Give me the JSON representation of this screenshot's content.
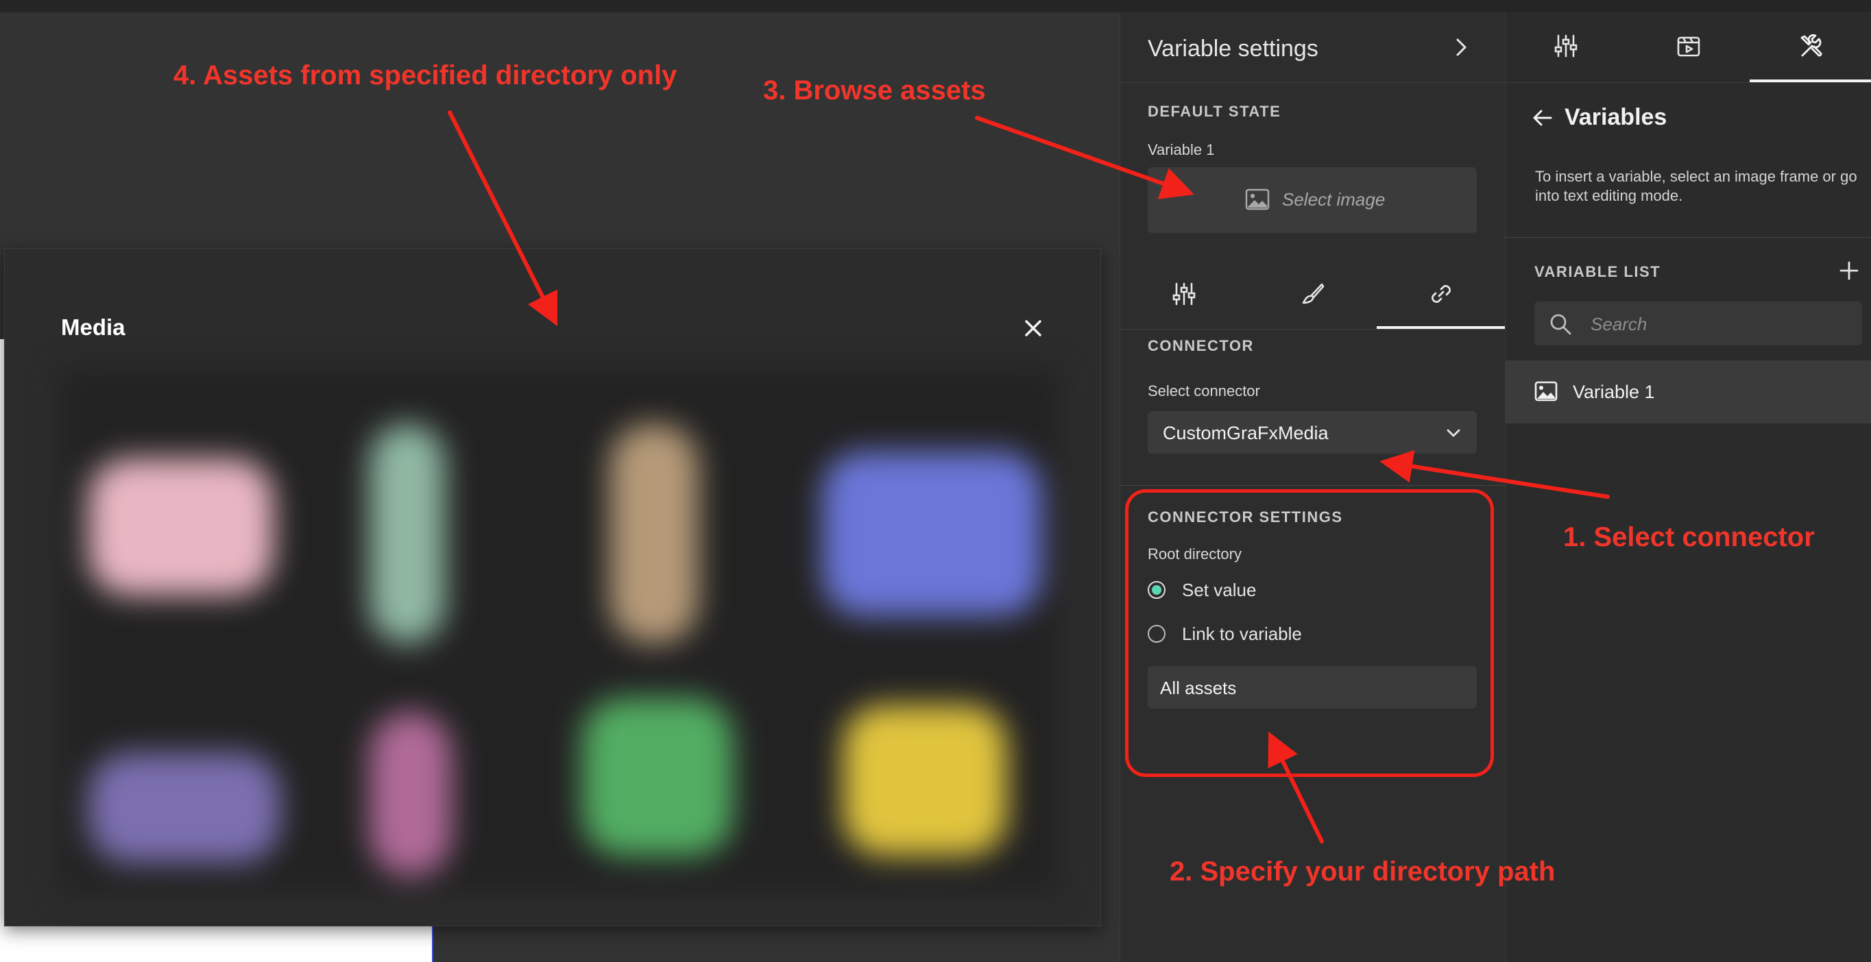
{
  "modal": {
    "title": "Media",
    "close_icon": "close-icon",
    "thumbnails": [
      {
        "color": "#e8b6c2"
      },
      {
        "color": "#8fb8a3"
      },
      {
        "color": "#b59a78"
      },
      {
        "color": "#6a76d8"
      },
      {
        "color": "#7b6fb0"
      },
      {
        "color": "#b06a98"
      },
      {
        "color": "#52ad62"
      },
      {
        "color": "#e0c43e"
      }
    ]
  },
  "variable_settings": {
    "title": "Variable settings",
    "default_state_label": "DEFAULT STATE",
    "variable_name": "Variable 1",
    "select_image_label": "Select image",
    "tabs": [
      "sliders-icon",
      "brush-icon",
      "link-icon"
    ],
    "active_tab": "link-icon",
    "connector_label": "CONNECTOR",
    "select_connector_label": "Select connector",
    "connector_value": "CustomGraFxMedia",
    "connector_settings_label": "CONNECTOR SETTINGS",
    "root_directory_label": "Root directory",
    "radio_set_value": "Set value",
    "radio_link_variable": "Link to variable",
    "selected_radio": "Set value",
    "directory_value": "All assets"
  },
  "variables_panel": {
    "tabs": [
      "sliders-icon",
      "film-icon",
      "tools-icon"
    ],
    "active_tab": "tools-icon",
    "title": "Variables",
    "help_text": "To insert a variable, select an image frame or go into text editing mode.",
    "list_label": "VARIABLE LIST",
    "search_placeholder": "Search",
    "items": [
      {
        "label": "Variable 1",
        "icon": "image-icon"
      }
    ]
  },
  "annotations": {
    "step1": "1. Select connector",
    "step2": "2. Specify your directory path",
    "step3": "3. Browse assets",
    "step4": "4. Assets from specified directory only",
    "color": "#f2352a"
  }
}
